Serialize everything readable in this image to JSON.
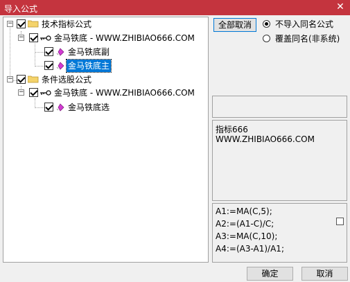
{
  "window": {
    "title": "导入公式",
    "close_glyph": "✕"
  },
  "tree": {
    "nodes": [
      {
        "label": "技术指标公式",
        "type": "category"
      },
      {
        "label": "金马铁底 - WWW.ZHIBIAO666.COM",
        "type": "package"
      },
      {
        "label": "金马铁底副",
        "type": "formula"
      },
      {
        "label": "金马铁底主",
        "type": "formula",
        "selected": true
      },
      {
        "label": "条件选股公式",
        "type": "category"
      },
      {
        "label": "金马铁底 - WWW.ZHIBIAO666.COM",
        "type": "package"
      },
      {
        "label": "金马铁底选",
        "type": "formula"
      }
    ],
    "expander_glyph": "−",
    "colors": {
      "folder": "#f4d36b",
      "gem": "#d23bd2",
      "selected": "#0078d7"
    }
  },
  "buttons": {
    "deselect_all": "全部取消",
    "ok": "确定",
    "cancel": "取消"
  },
  "options": {
    "skip_same_name": "不导入同名公式",
    "overwrite_same_name": "覆盖同名(非系统)",
    "selected": "skip_same_name"
  },
  "description": {
    "lines": [
      "指标666",
      "WWW.ZHIBIAO666.COM"
    ]
  },
  "code": {
    "lines": [
      "A1:=MA(C,5);",
      "A2:=(A1-C)/C;",
      "A3:=MA(C,10);",
      "A4:=(A3-A1)/A1;"
    ]
  }
}
